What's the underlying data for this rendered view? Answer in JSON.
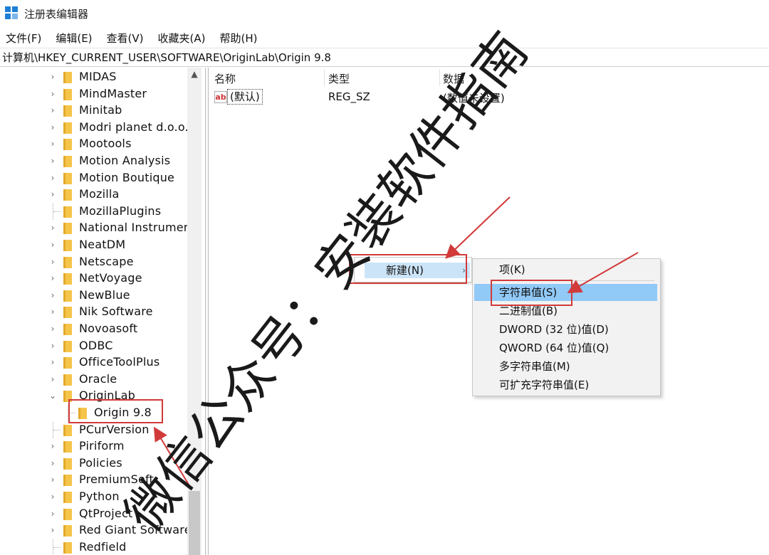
{
  "window": {
    "title": "注册表编辑器"
  },
  "menu": [
    "文件(F)",
    "编辑(E)",
    "查看(V)",
    "收藏夹(A)",
    "帮助(H)"
  ],
  "address": "计算机\\HKEY_CURRENT_USER\\SOFTWARE\\OriginLab\\Origin 9.8",
  "tree": {
    "items": [
      {
        "label": "MIDAS",
        "chevron": "›"
      },
      {
        "label": "MindMaster",
        "chevron": "›"
      },
      {
        "label": "Minitab",
        "chevron": "›"
      },
      {
        "label": "Modri planet d.o.o.",
        "chevron": "›"
      },
      {
        "label": "Mootools",
        "chevron": "›"
      },
      {
        "label": "Motion Analysis",
        "chevron": "›"
      },
      {
        "label": "Motion Boutique",
        "chevron": "›"
      },
      {
        "label": "Mozilla",
        "chevron": "›"
      },
      {
        "label": "MozillaPlugins",
        "chevron": ""
      },
      {
        "label": "National Instrumen",
        "chevron": "›"
      },
      {
        "label": "NeatDM",
        "chevron": "›"
      },
      {
        "label": "Netscape",
        "chevron": "›"
      },
      {
        "label": "NetVoyage",
        "chevron": "›"
      },
      {
        "label": "NewBlue",
        "chevron": "›"
      },
      {
        "label": "Nik Software",
        "chevron": "›"
      },
      {
        "label": "Novoasoft",
        "chevron": "›"
      },
      {
        "label": "ODBC",
        "chevron": "›"
      },
      {
        "label": "OfficeToolPlus",
        "chevron": "›"
      },
      {
        "label": "Oracle",
        "chevron": "›"
      },
      {
        "label": "OriginLab",
        "chevron": "⌄"
      },
      {
        "label": "Origin 9.8",
        "chevron": ""
      },
      {
        "label": "PCurVersion",
        "chevron": ""
      },
      {
        "label": "Piriform",
        "chevron": "›"
      },
      {
        "label": "Policies",
        "chevron": "›"
      },
      {
        "label": "PremiumSoft",
        "chevron": "›"
      },
      {
        "label": "Python",
        "chevron": "›"
      },
      {
        "label": "QtProject",
        "chevron": "›"
      },
      {
        "label": "Red Giant Software",
        "chevron": "›"
      },
      {
        "label": "Redfield",
        "chevron": ""
      }
    ],
    "scroll_up": "▲"
  },
  "columns": {
    "name": "名称",
    "type": "类型",
    "data": "数据"
  },
  "value": {
    "icon": "ab",
    "name": "(默认)",
    "type": "REG_SZ",
    "data": "(数值未设置)"
  },
  "context_menu": {
    "new_label": "新建(N)",
    "arrow": "›"
  },
  "submenu": [
    "项(K)",
    "字符串值(S)",
    "二进制值(B)",
    "DWORD (32 位)值(D)",
    "QWORD (64 位)值(Q)",
    "多字符串值(M)",
    "可扩充字符串值(E)"
  ],
  "watermark": "微信公众号：安装软件指南",
  "colors": {
    "annotation": "#d23a3a",
    "highlight": "#91c9f7",
    "folder": "#f5c54a"
  }
}
